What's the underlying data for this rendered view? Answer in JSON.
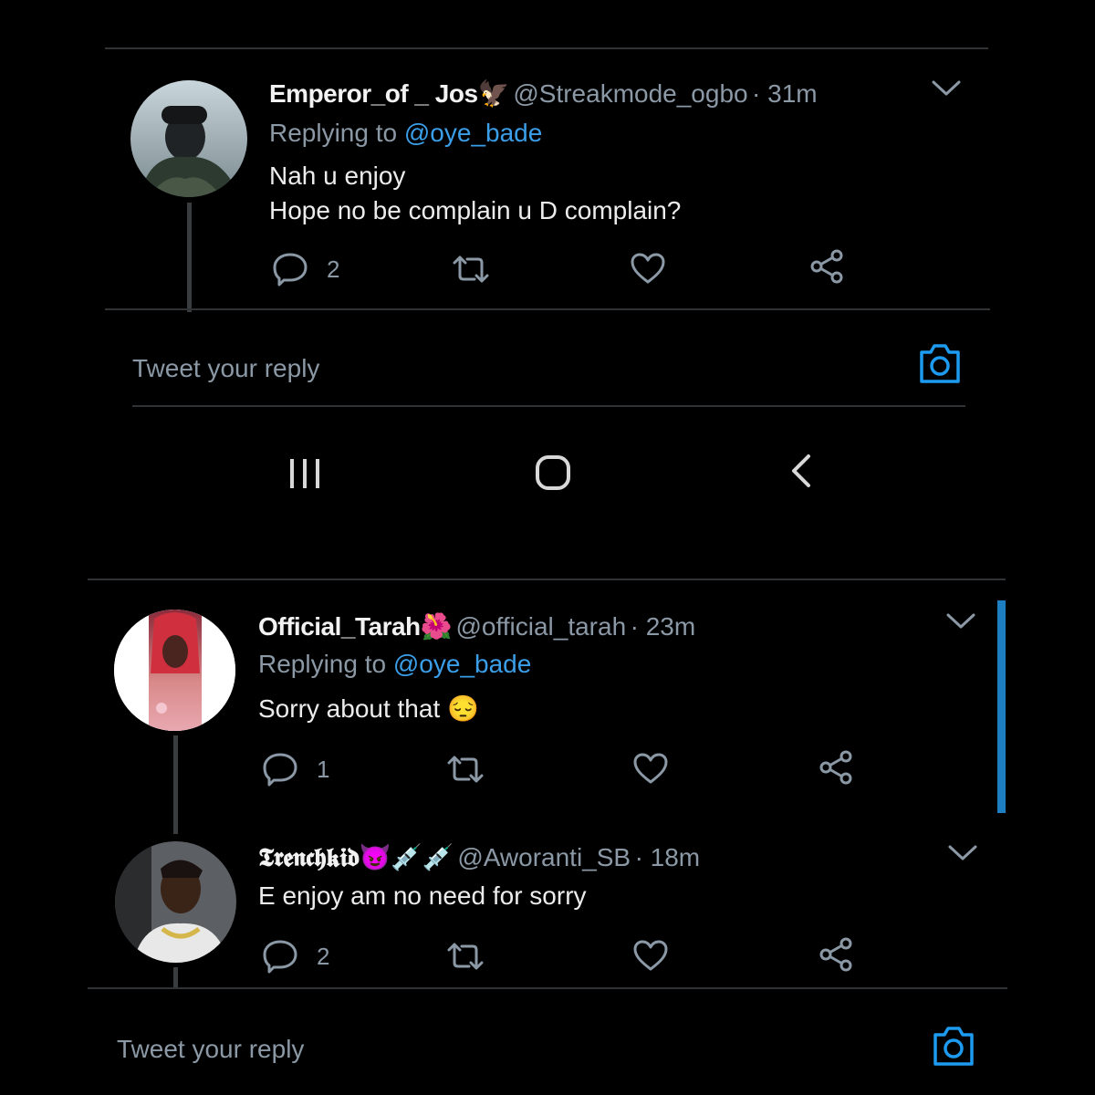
{
  "tweets": [
    {
      "name": "Emperor_of _ Jos🦅",
      "handle": "@Streakmode_ogbo",
      "time": "· 31m",
      "replying_prefix": "Replying to",
      "replying_to": "@oye_bade",
      "text_line1": "Nah u enjoy",
      "text_line2": "Hope no be complain u D complain?",
      "reply_count": "2"
    },
    {
      "name": "Official_Tarah🌺",
      "handle": "@official_tarah",
      "time": "· 23m",
      "replying_prefix": "Replying to",
      "replying_to": "@oye_bade",
      "text_line1": "Sorry about that 😔",
      "reply_count": "1"
    },
    {
      "name": "𝕿𝖗𝖊𝖓𝖈𝖍𝖐𝖎𝖉😈💉💉",
      "handle": "@Aworanti_SB",
      "time": "· 18m",
      "text_line1": "E enjoy am no need for sorry",
      "reply_count": "2"
    }
  ],
  "compose": {
    "placeholder": "Tweet your reply"
  },
  "colors": {
    "background": "#000000",
    "accent": "#1d9bf0",
    "muted": "#8b98a5"
  },
  "icons": [
    "reply-icon",
    "retweet-icon",
    "like-icon",
    "share-icon",
    "camera-icon",
    "chevron-down-icon",
    "recent-apps-icon",
    "home-icon",
    "back-icon"
  ]
}
